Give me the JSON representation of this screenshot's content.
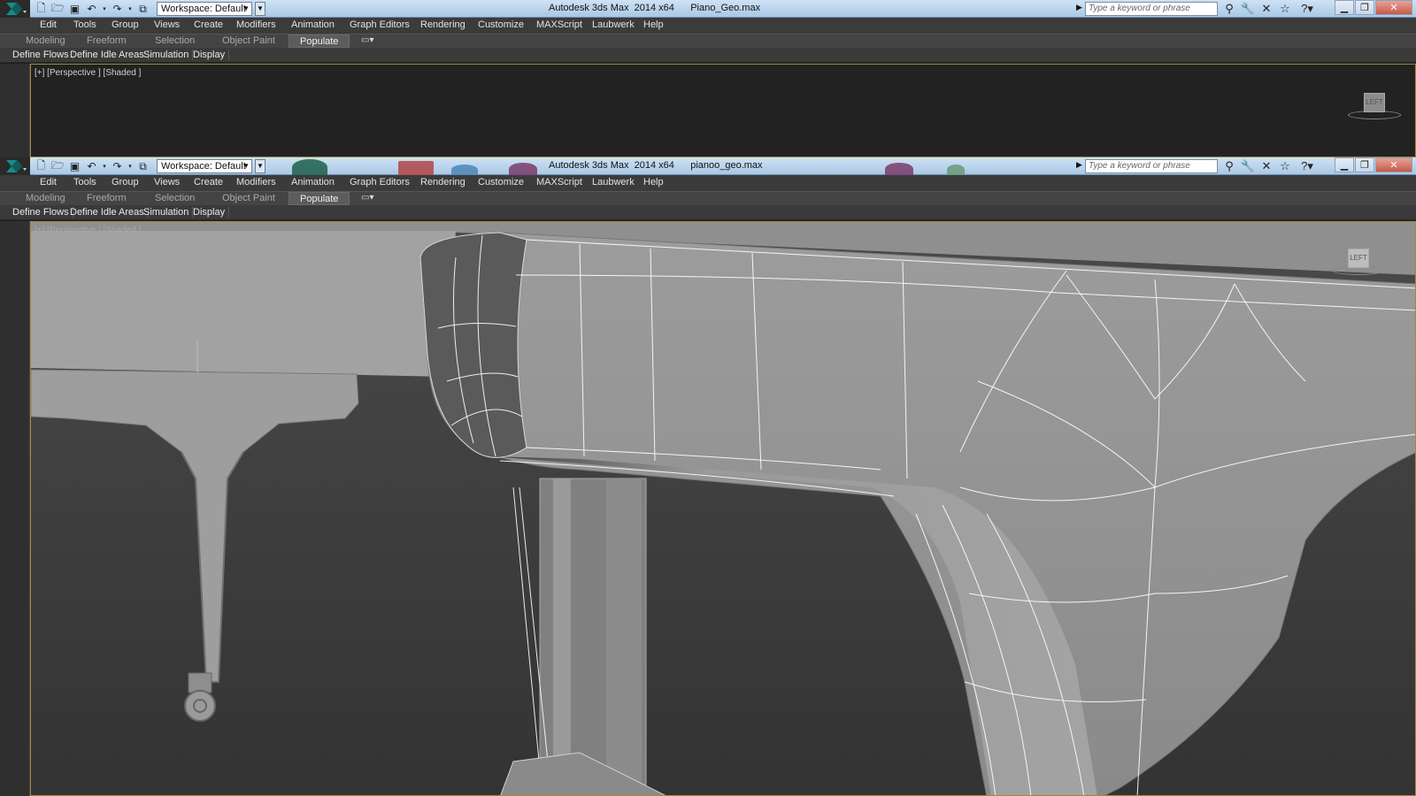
{
  "windows": [
    {
      "title": "Autodesk 3ds Max  2014 x64      Piano_Geo.max",
      "workspace": "Workspace: Default",
      "search_placeholder": "Type a keyword or phrase",
      "viewport_label": "[+] [Perspective ] [Shaded ]"
    },
    {
      "title": "Autodesk 3ds Max  2014 x64      pianoo_geo.max",
      "workspace": "Workspace: Default",
      "search_placeholder": "Type a keyword or phrase",
      "viewport_label": "[+] [Perspective ] [Shaded ]"
    }
  ],
  "menu": [
    "Edit",
    "Tools",
    "Group",
    "Views",
    "Create",
    "Modifiers",
    "Animation",
    "Graph Editors",
    "Rendering",
    "Customize",
    "MAXScript",
    "Laubwerk",
    "Help"
  ],
  "ribbon_tabs": [
    "Modeling",
    "Freeform",
    "Selection",
    "Object Paint",
    "Populate"
  ],
  "active_ribbon_tab": "Populate",
  "populate_subtabs": [
    "Define Flows",
    "Define Idle Areas",
    "Simulation",
    "Display"
  ],
  "icons": {
    "quick_access": [
      "new-file-icon",
      "open-folder-icon",
      "save-icon",
      "undo-icon",
      "redo-icon",
      "project-folder-icon"
    ],
    "title_tools": [
      "binoculars-icon",
      "wrench-icon",
      "communication-center-icon",
      "favorites-star-icon",
      "help-icon"
    ],
    "window_controls": [
      "minimize-icon",
      "restore-icon",
      "close-icon"
    ]
  },
  "colors": {
    "titlebar": "#b9d3ec",
    "menubar": "#3b3b3b",
    "viewport_border": "#a08a3a",
    "model_gray": "#9a9a9a"
  }
}
